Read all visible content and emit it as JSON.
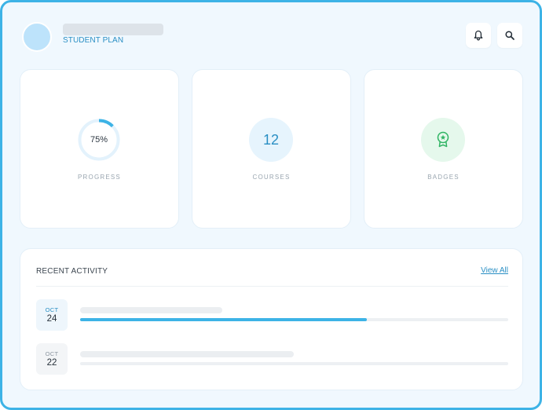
{
  "profile": {
    "plan_label": "STUDENT PLAN"
  },
  "header": {
    "icons": [
      "bell-icon",
      "search-icon"
    ]
  },
  "stats": {
    "progress": {
      "value_text": "75%",
      "fraction": 0.75,
      "label": "PROGRESS"
    },
    "courses": {
      "value_text": "12",
      "label": "COURSES"
    },
    "badges": {
      "icon": "ribbon-badge-icon",
      "label": "BADGES"
    }
  },
  "activity": {
    "title": "RECENT ACTIVITY",
    "view_all_label": "View All",
    "items": [
      {
        "month": "OCT",
        "day": "24",
        "progress_fraction": 0.67
      },
      {
        "month": "OCT",
        "day": "22",
        "progress_fraction": 0
      }
    ]
  },
  "colors": {
    "accent": "#3db3e6",
    "accent_text": "#2a8fc4",
    "badge_green": "#2fb463",
    "background": "#f0f8fe"
  }
}
